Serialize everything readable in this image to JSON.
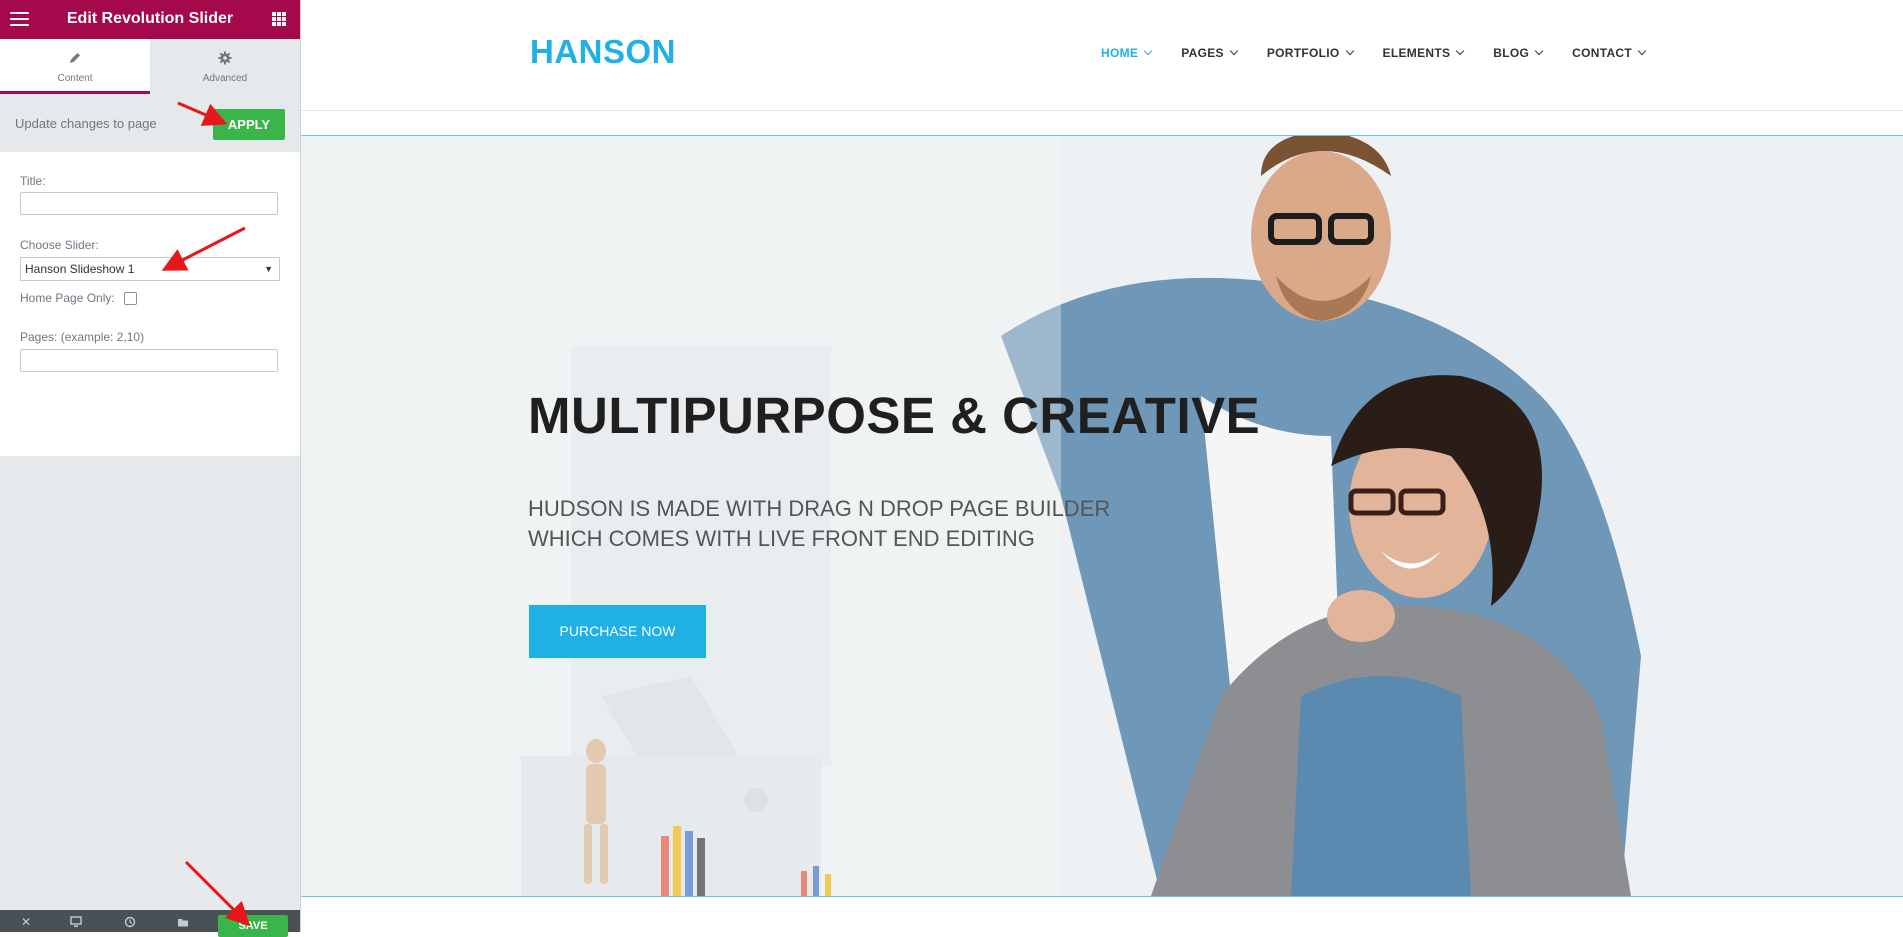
{
  "panel": {
    "title": "Edit Revolution Slider",
    "tabs": [
      {
        "label": "Content",
        "icon": "pencil-icon",
        "active": true
      },
      {
        "label": "Advanced",
        "icon": "gear-icon",
        "active": false
      }
    ],
    "apply_text": "Update changes to page",
    "apply_label": "APPLY",
    "fields": {
      "title_label": "Title:",
      "title_value": "",
      "choose_slider_label": "Choose Slider:",
      "choose_slider_value": "Hanson Slideshow 1",
      "home_only_label": "Home Page Only:",
      "home_only_checked": false,
      "pages_label": "Pages: (example: 2,10)",
      "pages_value": ""
    },
    "footer": {
      "icons": [
        "close-icon",
        "desktop-icon",
        "history-icon",
        "folder-icon"
      ],
      "save_label": "SAVE"
    },
    "colors": {
      "brand": "#a4094b",
      "apply": "#39b54a"
    }
  },
  "site": {
    "logo": "HANSON",
    "nav": [
      {
        "label": "HOME",
        "active": true
      },
      {
        "label": "PAGES",
        "active": false
      },
      {
        "label": "PORTFOLIO",
        "active": false
      },
      {
        "label": "ELEMENTS",
        "active": false
      },
      {
        "label": "BLOG",
        "active": false
      },
      {
        "label": "CONTACT",
        "active": false
      }
    ],
    "hero": {
      "title": "MULTIPURPOSE & CREATIVE",
      "subtitle_line1": "HUDSON IS MADE WITH DRAG N DROP PAGE BUILDER",
      "subtitle_line2": "WHICH COMES WITH LIVE FRONT END EDITING",
      "button": "PURCHASE NOW"
    },
    "colors": {
      "accent": "#1fb1e6"
    }
  }
}
